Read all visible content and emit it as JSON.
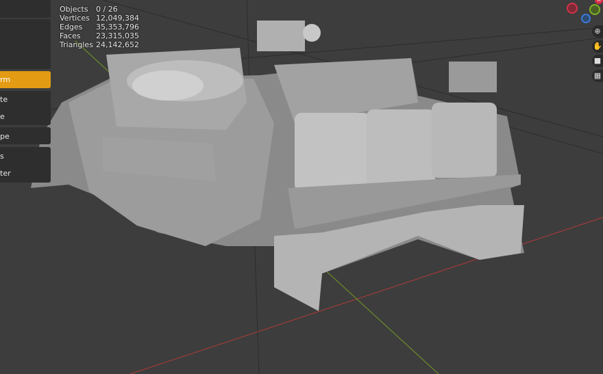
{
  "stats": {
    "rows": [
      {
        "label": "Objects",
        "value": "0 / 26"
      },
      {
        "label": "Vertices",
        "value": "12,049,384"
      },
      {
        "label": "Edges",
        "value": "35,353,796"
      },
      {
        "label": "Faces",
        "value": "23,315,035"
      },
      {
        "label": "Triangles",
        "value": "24,142,652"
      }
    ]
  },
  "sidebar_menu": {
    "items": [
      {
        "label": "rm",
        "active": true
      },
      {
        "label": "te"
      },
      {
        "label": "e"
      },
      {
        "label": "pe"
      },
      {
        "label": "s"
      },
      {
        "label": "ter"
      }
    ]
  },
  "gizmo": {
    "x_label": "X",
    "colors": {
      "x": "#d9304a",
      "y": "#80b327",
      "z": "#3a7bd5"
    }
  },
  "nav_buttons": [
    "zoom-icon",
    "hand-pan-icon",
    "camera-icon",
    "grid-view-icon"
  ],
  "colors": {
    "accent": "#e39b13",
    "background": "#3d3d3d",
    "x_axis": "#a03a3a",
    "y_axis": "#6c8c2a"
  }
}
